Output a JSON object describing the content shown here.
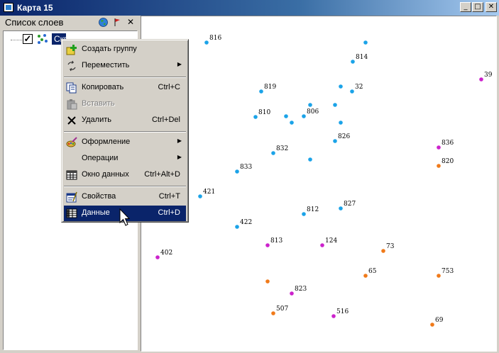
{
  "window": {
    "title": "Карта 15",
    "min_glyph": "_",
    "max_glyph": "□",
    "close_glyph": "✕"
  },
  "panel": {
    "title": "Список слоев",
    "close_glyph": "✕"
  },
  "tree": {
    "layer_label": "Скважины",
    "checked": true,
    "check_glyph": "✓"
  },
  "menu": {
    "items": [
      {
        "label": "Создать группу",
        "shortcut": "",
        "submenu": false,
        "icon": "add-group-icon",
        "disabled": false,
        "selected": false
      },
      {
        "label": "Переместить",
        "shortcut": "",
        "submenu": true,
        "icon": "move-icon",
        "disabled": false,
        "selected": false
      },
      {
        "label": "Копировать",
        "shortcut": "Ctrl+C",
        "submenu": false,
        "icon": "copy-icon",
        "disabled": false,
        "selected": false
      },
      {
        "label": "Вставить",
        "shortcut": "",
        "submenu": false,
        "icon": "paste-icon",
        "disabled": true,
        "selected": false
      },
      {
        "label": "Удалить",
        "shortcut": "Ctrl+Del",
        "submenu": false,
        "icon": "delete-icon",
        "disabled": false,
        "selected": false
      },
      {
        "label": "Оформление",
        "shortcut": "",
        "submenu": true,
        "icon": "style-icon",
        "disabled": false,
        "selected": false
      },
      {
        "label": "Операции",
        "shortcut": "",
        "submenu": true,
        "icon": "",
        "disabled": false,
        "selected": false
      },
      {
        "label": "Окно данных",
        "shortcut": "Ctrl+Alt+D",
        "submenu": false,
        "icon": "data-window-icon",
        "disabled": false,
        "selected": false
      },
      {
        "label": "Свойства",
        "shortcut": "Ctrl+T",
        "submenu": false,
        "icon": "properties-icon",
        "disabled": false,
        "selected": false
      },
      {
        "label": "Данные",
        "shortcut": "Ctrl+D",
        "submenu": false,
        "icon": "data-table-icon",
        "disabled": false,
        "selected": true
      }
    ],
    "submenu_glyph": "▶"
  },
  "map": {
    "colors": {
      "blue": "#1ba3e8",
      "magenta": "#cc22cc",
      "orange": "#f07a1a"
    },
    "points": [
      {
        "label": "816",
        "color": "blue"
      },
      {
        "label": "",
        "color": "blue"
      },
      {
        "label": "814",
        "color": "blue"
      },
      {
        "label": "39",
        "color": "magenta"
      },
      {
        "label": "819",
        "color": "blue"
      },
      {
        "label": "",
        "color": "blue"
      },
      {
        "label": "32",
        "color": "blue"
      },
      {
        "label": "",
        "color": "blue"
      },
      {
        "label": "810",
        "color": "blue"
      },
      {
        "label": "",
        "color": "blue"
      },
      {
        "label": "",
        "color": "blue"
      },
      {
        "label": "806",
        "color": "blue"
      },
      {
        "label": "",
        "color": "blue"
      },
      {
        "label": "",
        "color": "blue"
      },
      {
        "label": "826",
        "color": "blue"
      },
      {
        "label": "836",
        "color": "magenta"
      },
      {
        "label": "832",
        "color": "blue"
      },
      {
        "label": "",
        "color": "blue"
      },
      {
        "label": "820",
        "color": "orange"
      },
      {
        "label": "833",
        "color": "blue"
      },
      {
        "label": "421",
        "color": "blue"
      },
      {
        "label": "827",
        "color": "blue"
      },
      {
        "label": "812",
        "color": "blue"
      },
      {
        "label": "422",
        "color": "blue"
      },
      {
        "label": "813",
        "color": "magenta"
      },
      {
        "label": "124",
        "color": "magenta"
      },
      {
        "label": "73",
        "color": "orange"
      },
      {
        "label": "402",
        "color": "magenta"
      },
      {
        "label": "65",
        "color": "orange"
      },
      {
        "label": "753",
        "color": "orange"
      },
      {
        "label": "",
        "color": "orange"
      },
      {
        "label": "823",
        "color": "magenta"
      },
      {
        "label": "507",
        "color": "orange"
      },
      {
        "label": "516",
        "color": "magenta"
      },
      {
        "label": "69",
        "color": "orange"
      }
    ]
  }
}
